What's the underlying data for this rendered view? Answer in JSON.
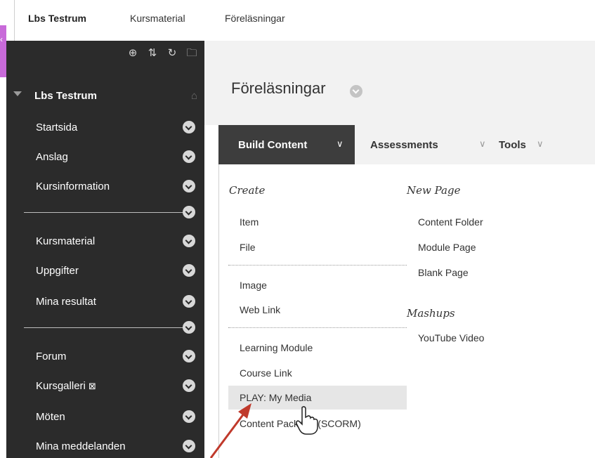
{
  "breadcrumb": {
    "course": "Lbs Testrum",
    "item2": "Kursmaterial",
    "item3": "Föreläsningar"
  },
  "sidebar": {
    "tools": [
      {
        "icon": "add-circle-icon",
        "glyph": "⊕"
      },
      {
        "icon": "sort-icon",
        "glyph": "⇅"
      },
      {
        "icon": "refresh-icon",
        "glyph": "↻"
      },
      {
        "icon": "folder-icon",
        "glyph": "🗀"
      }
    ],
    "course_name": "Lbs Testrum",
    "items": [
      {
        "label": "Startsida"
      },
      {
        "label": "Anslag"
      },
      {
        "label": "Kursinformation"
      },
      {
        "label": "Kursmaterial"
      },
      {
        "label": "Uppgifter"
      },
      {
        "label": "Mina resultat"
      },
      {
        "label": "Forum"
      },
      {
        "label": "Kursgalleri"
      },
      {
        "label": "Möten"
      },
      {
        "label": "Mina meddelanden"
      }
    ],
    "hidden_badge": "⊠"
  },
  "page": {
    "title": "Föreläsningar"
  },
  "actionbar": {
    "build_content": "Build Content",
    "assessments": "Assessments",
    "tools": "Tools",
    "caret": "∨"
  },
  "dropdown": {
    "create_heading": "Create",
    "create_items": [
      "Item",
      "File",
      "Image",
      "Web Link",
      "Learning Module",
      "Course Link",
      "PLAY: My Media",
      "Content Package (SCORM)"
    ],
    "new_page_heading": "New Page",
    "new_page_items": [
      "Content Folder",
      "Module Page",
      "Blank Page"
    ],
    "mashups_heading": "Mashups",
    "mashups_items": [
      "YouTube Video"
    ],
    "highlighted": "PLAY: My Media"
  },
  "colors": {
    "sidebar_bg": "#2b2b2b",
    "accent_tab": "#c86ad9",
    "arrow": "#c0392b"
  }
}
